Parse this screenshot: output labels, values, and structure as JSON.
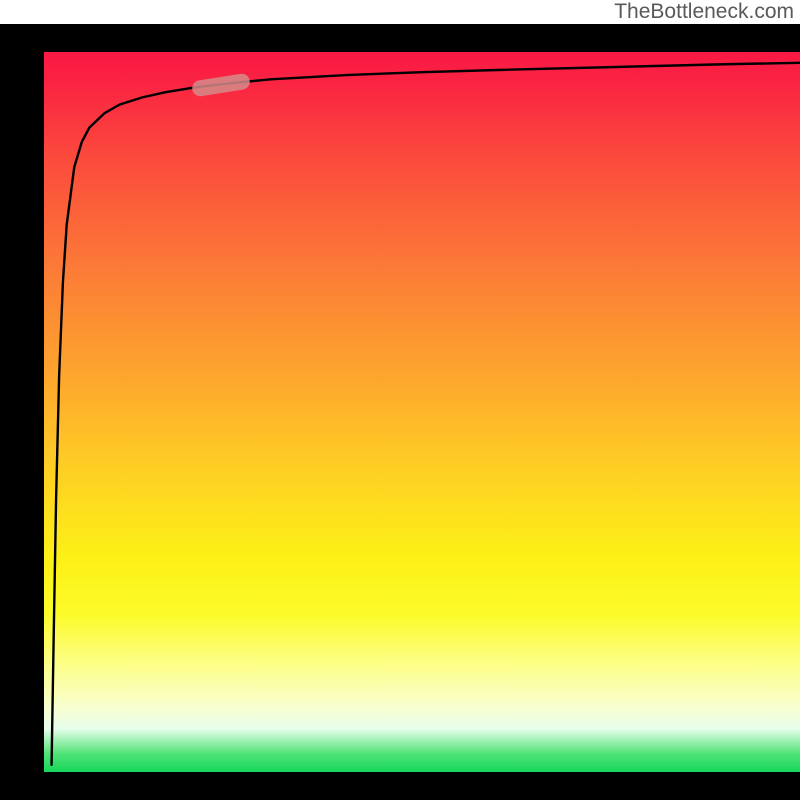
{
  "watermark": "TheBottleneck.com",
  "colors": {
    "frame": "#000000",
    "curve": "#000000",
    "marker": "#d48b8a",
    "gradient_top": "#f91845",
    "gradient_mid1": "#fda32e",
    "gradient_mid2": "#fcfb29",
    "gradient_bottom": "#16d85c"
  },
  "chart_data": {
    "type": "line",
    "title": "",
    "xlabel": "",
    "ylabel": "",
    "xlim": [
      0,
      100
    ],
    "ylim": [
      0,
      100
    ],
    "grid": false,
    "legend": false,
    "series": [
      {
        "name": "curve",
        "x": [
          1.0,
          1.3,
          1.6,
          2.0,
          2.5,
          3.0,
          4.0,
          5.0,
          6.0,
          8.0,
          10.0,
          13.0,
          16.0,
          20.0,
          25.0,
          30.0,
          40.0,
          50.0,
          60.0,
          75.0,
          90.0,
          100.0
        ],
        "y": [
          1.0,
          20.0,
          38.0,
          55.0,
          68.0,
          76.0,
          84.0,
          87.5,
          89.5,
          91.5,
          92.7,
          93.7,
          94.4,
          95.1,
          95.7,
          96.2,
          96.8,
          97.2,
          97.5,
          97.9,
          98.3,
          98.5
        ]
      }
    ],
    "marker": {
      "series": "curve",
      "x_range": [
        20,
        27
      ],
      "y_range": [
        95.0,
        95.8
      ],
      "shape": "pill"
    },
    "background_gradient": {
      "direction": "vertical",
      "stops": [
        {
          "pos": 0.0,
          "meaning": "worst",
          "color": "#f91845"
        },
        {
          "pos": 0.5,
          "meaning": "mid",
          "color": "#fdc127"
        },
        {
          "pos": 0.78,
          "meaning": "good",
          "color": "#fcfb29"
        },
        {
          "pos": 1.0,
          "meaning": "best",
          "color": "#16d85c"
        }
      ]
    }
  }
}
